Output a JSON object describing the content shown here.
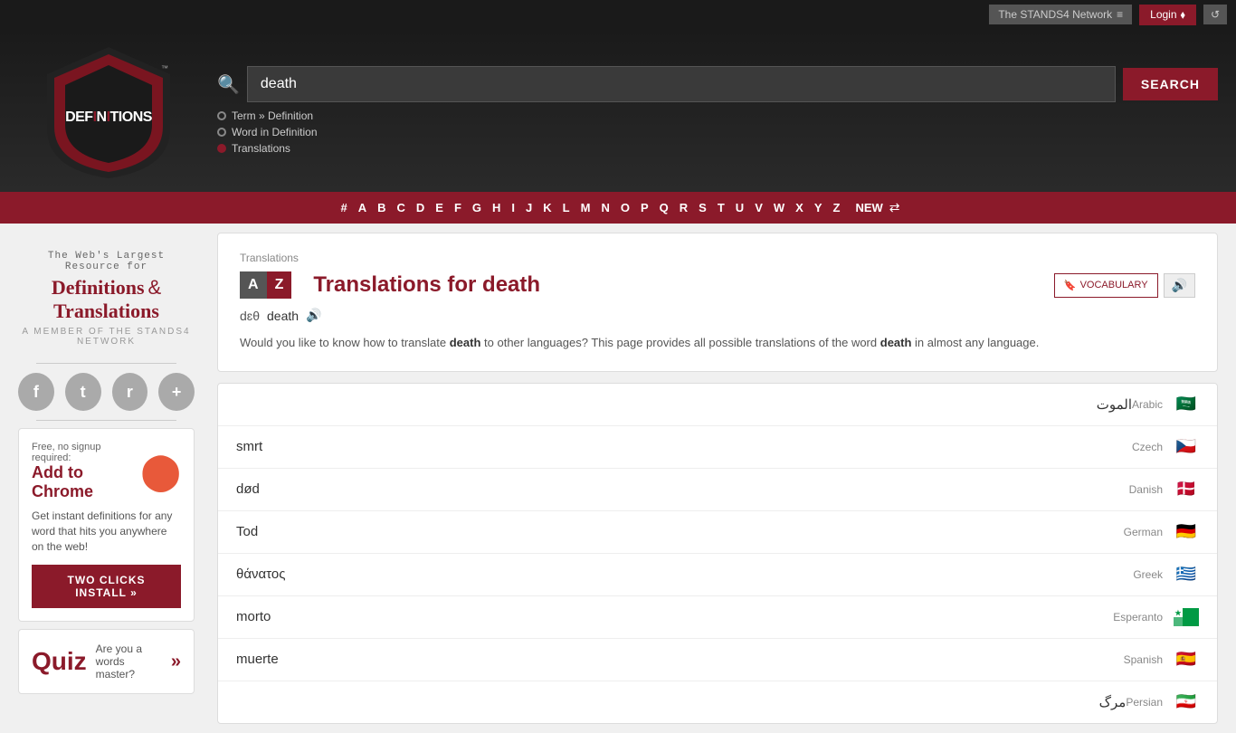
{
  "topbar": {
    "network_label": "The STANDS4 Network",
    "login_label": "Login",
    "history_icon": "↺"
  },
  "header": {
    "search_placeholder": "death",
    "search_value": "death",
    "search_button": "SEARCH",
    "options": [
      {
        "label": "Term » Definition",
        "active": false
      },
      {
        "label": "Word in Definition",
        "active": false
      },
      {
        "label": "Translations",
        "active": true
      }
    ]
  },
  "alpha_nav": {
    "letters": [
      "#",
      "A",
      "B",
      "C",
      "D",
      "E",
      "F",
      "G",
      "H",
      "I",
      "J",
      "K",
      "L",
      "M",
      "N",
      "O",
      "P",
      "Q",
      "R",
      "S",
      "T",
      "U",
      "V",
      "W",
      "X",
      "Y",
      "Z"
    ],
    "new_label": "NEW",
    "shuffle_icon": "⇄"
  },
  "sidebar": {
    "tagline_top": "The Web's Largest Resource for",
    "tagline_main": "Definitions",
    "tagline_amp": "&",
    "tagline_translations": "Translations",
    "tagline_sub": "A MEMBER OF THE STANDS4 NETWORK",
    "chrome_free": "Free, no signup required:",
    "chrome_title": "Add to Chrome",
    "chrome_desc": "Get instant definitions for any word that hits you anywhere on the web!",
    "chrome_install": "TWO CLICKS INSTALL »",
    "quiz_title": "Quiz",
    "quiz_text": "Are you a words master?",
    "quiz_arrow": "»"
  },
  "translations": {
    "breadcrumb": "Translations",
    "title": "Translations for death",
    "phonetic_ipa": "dɛθ",
    "phonetic_word": "death",
    "vocab_btn": "VOCABULARY",
    "description": "Would you like to know how to translate",
    "description_word": "death",
    "description_mid": "to other languages? This page provides all possible translations of the word",
    "description_word2": "death",
    "description_end": "in almost any language.",
    "rows": [
      {
        "word": "الموت",
        "lang": "Arabic",
        "flag": "🇸🇦"
      },
      {
        "word": "smrt",
        "lang": "Czech",
        "flag": "🇨🇿"
      },
      {
        "word": "død",
        "lang": "Danish",
        "flag": "🇩🇰"
      },
      {
        "word": "Tod",
        "lang": "German",
        "flag": "🇩🇪"
      },
      {
        "word": "θάνατος",
        "lang": "Greek",
        "flag": "🇬🇷"
      },
      {
        "word": "morto",
        "lang": "Esperanto",
        "flag": "🟩"
      },
      {
        "word": "muerte",
        "lang": "Spanish",
        "flag": "🇪🇸"
      },
      {
        "word": "مرگ",
        "lang": "Persian",
        "flag": "🇮🇷"
      }
    ]
  }
}
